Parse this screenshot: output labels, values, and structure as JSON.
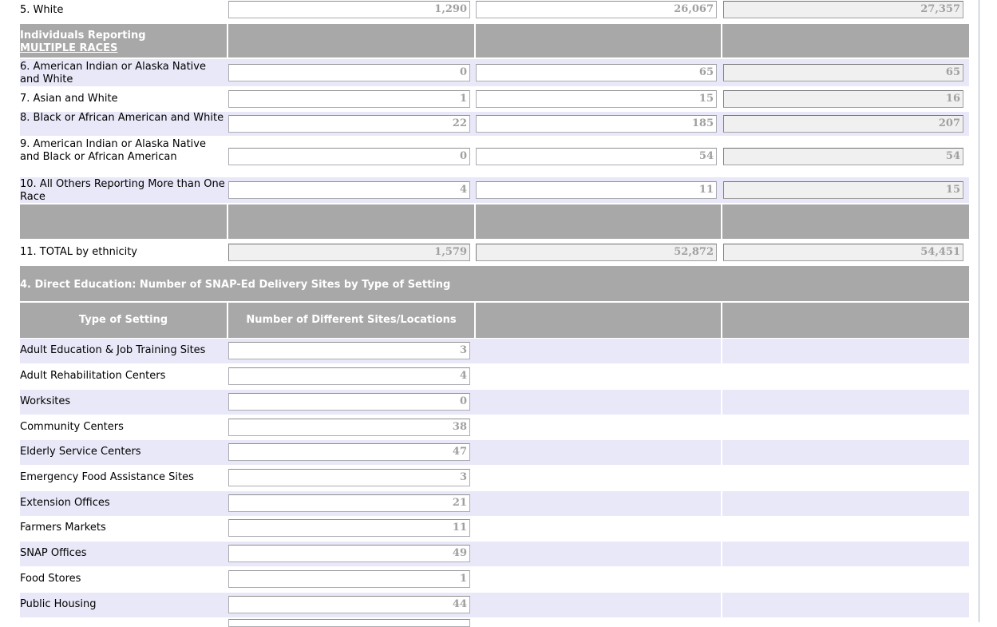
{
  "race_rows": {
    "white": {
      "label": "5. White",
      "col1": "1,290",
      "col2": "26,067",
      "total": "27,357"
    },
    "multi_header": {
      "line1": "Individuals Reporting",
      "line2": "MULTIPLE RACES"
    },
    "r6": {
      "label": "6. American Indian or Alaska Native and White",
      "col1": "0",
      "col2": "65",
      "total": "65"
    },
    "r7": {
      "label": "7. Asian and White",
      "col1": "1",
      "col2": "15",
      "total": "16"
    },
    "r8": {
      "label": "8. Black or African American and White",
      "col1": "22",
      "col2": "185",
      "total": "207"
    },
    "r9": {
      "label": "9. American Indian or Alaska Native and Black or African American",
      "col1": "0",
      "col2": "54",
      "total": "54"
    },
    "r10": {
      "label": "10. All Others Reporting More than One Race",
      "col1": "4",
      "col2": "11",
      "total": "15"
    },
    "r11": {
      "label": "11. TOTAL by ethnicity",
      "col1": "1,579",
      "col2": "52,872",
      "total": "54,451"
    }
  },
  "section4": {
    "title": "4. Direct Education: Number of SNAP-Ed Delivery Sites by Type of Setting",
    "col_type": "Type of Setting",
    "col_sites": "Number of Different Sites/Locations",
    "sites": [
      {
        "label": "Adult Education & Job Training Sites",
        "value": "3"
      },
      {
        "label": "Adult Rehabilitation Centers",
        "value": "4"
      },
      {
        "label": "Worksites",
        "value": "0"
      },
      {
        "label": "Community Centers",
        "value": "38"
      },
      {
        "label": "Elderly Service Centers",
        "value": "47"
      },
      {
        "label": "Emergency Food Assistance Sites",
        "value": "3"
      },
      {
        "label": "Extension Offices",
        "value": "21"
      },
      {
        "label": "Farmers Markets",
        "value": "11"
      },
      {
        "label": "SNAP Offices",
        "value": "49"
      },
      {
        "label": "Food Stores",
        "value": "1"
      },
      {
        "label": "Public Housing",
        "value": "44"
      }
    ]
  }
}
